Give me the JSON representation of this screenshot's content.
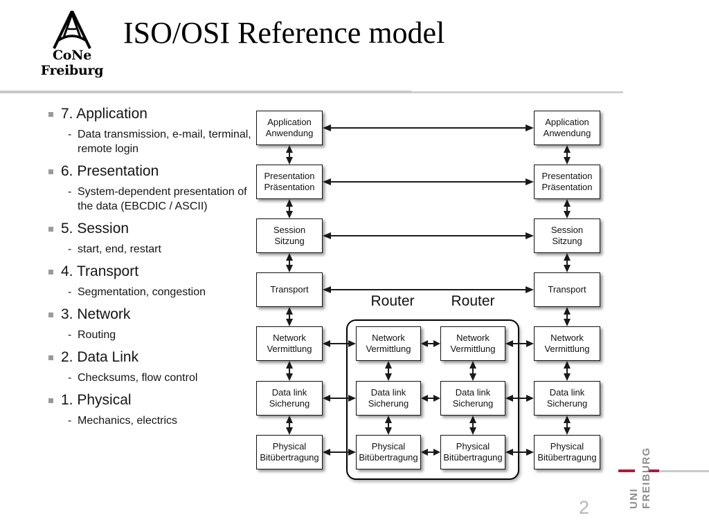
{
  "slide": {
    "title": "ISO/OSI Reference model",
    "page_number": "2",
    "logo": {
      "line1": "CoNe",
      "line2": "Freiburg",
      "icon": "antenna-tower-icon"
    },
    "university_logo": {
      "line1": "UNI",
      "line2": "FREIBURG",
      "accent_color": "#ad1b3c",
      "text_color": "#8d8d8d"
    }
  },
  "layer_list": [
    {
      "heading": "7. Application",
      "sub_dash": "-",
      "sub": "Data transmission, e-mail, terminal, remote login"
    },
    {
      "heading": "6. Presentation",
      "sub_dash": "-",
      "sub": "System-dependent presentation of the data (EBCDIC / ASCII)"
    },
    {
      "heading": "5. Session",
      "sub_dash": "-",
      "sub": "start, end, restart"
    },
    {
      "heading": "4. Transport",
      "sub_dash": "-",
      "sub": "Segmentation, congestion"
    },
    {
      "heading": "3. Network",
      "sub_dash": "-",
      "sub": "Routing"
    },
    {
      "heading": "2. Data Link",
      "sub_dash": "-",
      "sub": "Checksums, flow control"
    },
    {
      "heading": "1. Physical",
      "sub_dash": "-",
      "sub": "Mechanics, electrics"
    }
  ],
  "diagram": {
    "router_labels": [
      "Router",
      "Router"
    ],
    "host_left": [
      {
        "en": "Application",
        "de": "Anwendung"
      },
      {
        "en": "Presentation",
        "de": "Präsentation"
      },
      {
        "en": "Session",
        "de": "Sitzung"
      },
      {
        "en": "Transport",
        "de": ""
      },
      {
        "en": "Network",
        "de": "Vermittlung"
      },
      {
        "en": "Data link",
        "de": "Sicherung"
      },
      {
        "en": "Physical",
        "de": "Bitübertragung"
      }
    ],
    "host_right": [
      {
        "en": "Application",
        "de": "Anwendung"
      },
      {
        "en": "Presentation",
        "de": "Präsentation"
      },
      {
        "en": "Session",
        "de": "Sitzung"
      },
      {
        "en": "Transport",
        "de": ""
      },
      {
        "en": "Network",
        "de": "Vermittlung"
      },
      {
        "en": "Data link",
        "de": "Sicherung"
      },
      {
        "en": "Physical",
        "de": "Bitübertragung"
      }
    ],
    "router_a": [
      {
        "en": "Network",
        "de": "Vermittlung"
      },
      {
        "en": "Data link",
        "de": "Sicherung"
      },
      {
        "en": "Physical",
        "de": "Bitübertragung"
      }
    ],
    "router_b": [
      {
        "en": "Network",
        "de": "Vermittlung"
      },
      {
        "en": "Data link",
        "de": "Sicherung"
      },
      {
        "en": "Physical",
        "de": "Bitübertragung"
      }
    ]
  }
}
